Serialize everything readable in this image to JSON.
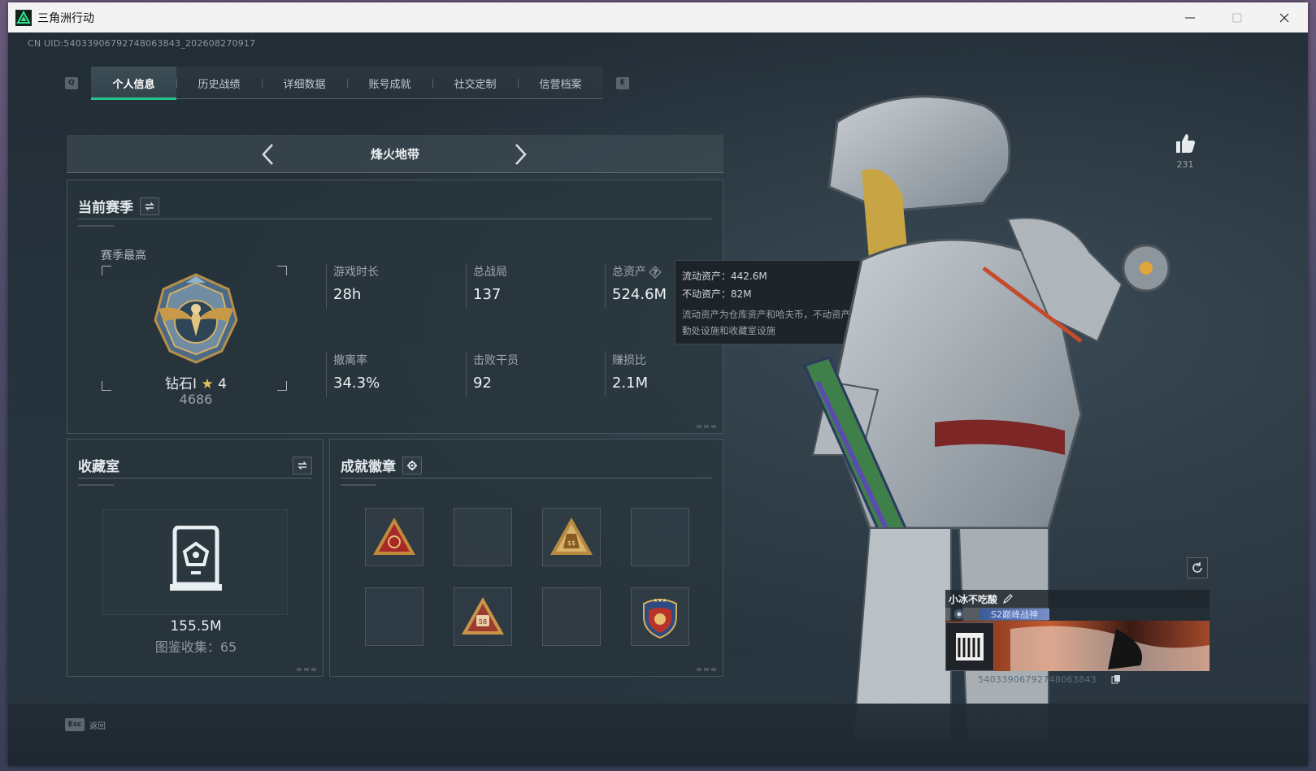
{
  "window": {
    "title": "三角洲行动",
    "controls": [
      "minimize",
      "maximize",
      "close"
    ]
  },
  "uid_line": "CN UID:540339067927480638​43_202608270917",
  "tabs": {
    "left_key": "Q",
    "right_key": "E",
    "items": [
      {
        "label": "个人信息",
        "active": true
      },
      {
        "label": "历史战绩",
        "active": false
      },
      {
        "label": "详细数据",
        "active": false
      },
      {
        "label": "账号成就",
        "active": false
      },
      {
        "label": "社交定制",
        "active": false
      },
      {
        "label": "信营档案",
        "active": false
      }
    ]
  },
  "mode_selector": {
    "title": "烽火地带"
  },
  "current_season": {
    "title": "当前赛季",
    "rank_label": "赛季最高",
    "rank_name": "钻石I",
    "rank_stars": "4",
    "rank_score": "4686",
    "stats": [
      {
        "label": "游戏时长",
        "value": "28h"
      },
      {
        "label": "总战局",
        "value": "137"
      },
      {
        "label": "总资产",
        "value": "524.6M"
      },
      {
        "label": "撤离率",
        "value": "34.3%"
      },
      {
        "label": "击败干员",
        "value": "92"
      },
      {
        "label": "赚损比",
        "value": "2.1M"
      }
    ]
  },
  "asset_tooltip": {
    "liquid": "流动资产：442.6M",
    "fixed": "不动资产：82M",
    "note": "流动资产为仓库资产和哈夫币，不动资产为特勤处设施和收藏室设施"
  },
  "collection": {
    "title": "收藏室",
    "value": "155.5M",
    "sub": "图鉴收集：65"
  },
  "achievements": {
    "title": "成就徽章",
    "badges": [
      "red-triangle-emblem",
      "empty",
      "money-bag-triangle",
      "empty",
      "empty",
      "58-triangle-emblem",
      "empty",
      "shield-eagle-emblem"
    ]
  },
  "likes": {
    "count": "231"
  },
  "player_card": {
    "name": "小冰不吃酸",
    "title": "S2巅峰战神",
    "uid": "540339067927480638​43"
  },
  "bottom": {
    "esc_key": "Esc",
    "back_label": "返回"
  },
  "colors": {
    "accent": "#22c58a",
    "panel_bg": "#28343c",
    "window_bg": "#1c252d"
  }
}
